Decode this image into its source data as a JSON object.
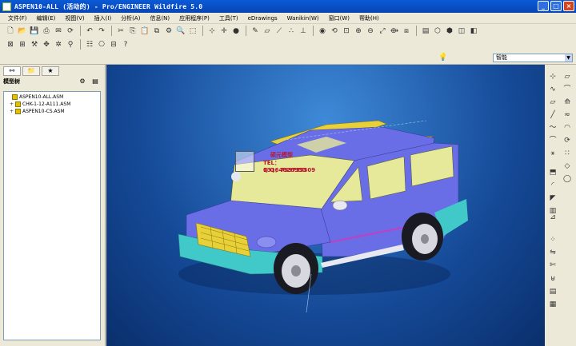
{
  "window": {
    "title": "ASPEN10-ALL (活动的) - Pro/ENGINEER Wildfire 5.0"
  },
  "menu": [
    {
      "label": "文件(F)"
    },
    {
      "label": "编辑(E)"
    },
    {
      "label": "视图(V)"
    },
    {
      "label": "插入(I)"
    },
    {
      "label": "分析(A)"
    },
    {
      "label": "信息(N)"
    },
    {
      "label": "应用程序(P)"
    },
    {
      "label": "工具(T)"
    },
    {
      "label": "eDrawings"
    },
    {
      "label": "Wanikin(W)"
    },
    {
      "label": "窗口(W)"
    },
    {
      "label": "帮助(H)"
    }
  ],
  "filter": {
    "value": "智能"
  },
  "panel": {
    "title": "模型树"
  },
  "tree": [
    {
      "label": "ASPEN10-ALL.ASM",
      "indent": 0,
      "expander": ""
    },
    {
      "label": "CHK-1-12-A111.ASM",
      "indent": 1,
      "expander": "+"
    },
    {
      "label": "ASPEN10-CS.ASM",
      "indent": 1,
      "expander": "+"
    }
  ],
  "watermark": {
    "name": "硕元模型",
    "tel": "TEL：13164628950",
    "qq": "Q Q：799735509"
  },
  "colors": {
    "body": "#6a6ee6",
    "glass": "#e6e89a",
    "bumper": "#41c8c8",
    "grille": "#e8d038"
  }
}
